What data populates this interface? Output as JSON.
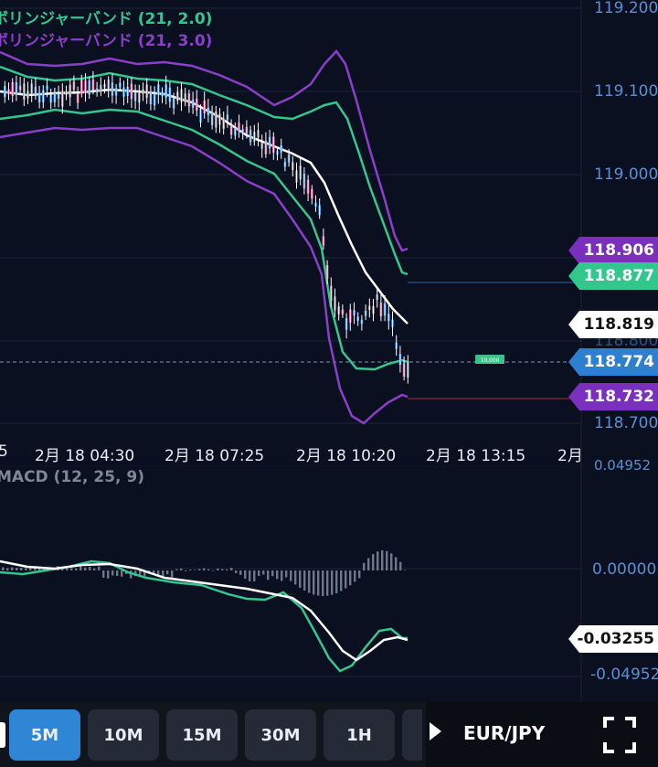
{
  "indicators": {
    "bb1": {
      "label": "ボリンジャーバンド (21, 2.0)",
      "color": "#35c58f"
    },
    "bb2": {
      "label": "ボリンジャーバンド (21, 3.0)",
      "color": "#8a3fc9"
    },
    "macd": {
      "label": "MACD (12, 25, 9)",
      "color": "#7f8797"
    }
  },
  "price_axis": {
    "labels": [
      "119.200",
      "119.100",
      "119.000",
      "118.800",
      "118.700"
    ],
    "top_cut": "0.04952"
  },
  "price_tags": [
    {
      "value": "118.906",
      "kind": "bb3-upper",
      "bg": "#7b2fbf",
      "fg": "#ffffff"
    },
    {
      "value": "118.877",
      "kind": "bb2-upper",
      "bg": "#31c88e",
      "fg": "#ffffff"
    },
    {
      "value": "118.819",
      "kind": "sma",
      "bg": "#ffffff",
      "fg": "#111111"
    },
    {
      "value": "118.774",
      "kind": "current",
      "bg": "#2f7fd0",
      "fg": "#ffffff"
    },
    {
      "value": "118.732",
      "kind": "bb3-lower",
      "bg": "#7b2fbf",
      "fg": "#ffffff"
    }
  ],
  "time_axis": [
    "5",
    "2月 18 04:30",
    "2月 18 07:25",
    "2月 18 10:20",
    "2月 18 13:15",
    "2月"
  ],
  "order_badge": "10,000",
  "macd_axis": {
    "zero": "0.00000",
    "low": "-0.04952",
    "tag": "-0.03255"
  },
  "toolbar": {
    "timeframes": [
      "5M",
      "10M",
      "15M",
      "30M",
      "1H"
    ],
    "active": "5M",
    "symbol": "EUR/JPY"
  }
}
